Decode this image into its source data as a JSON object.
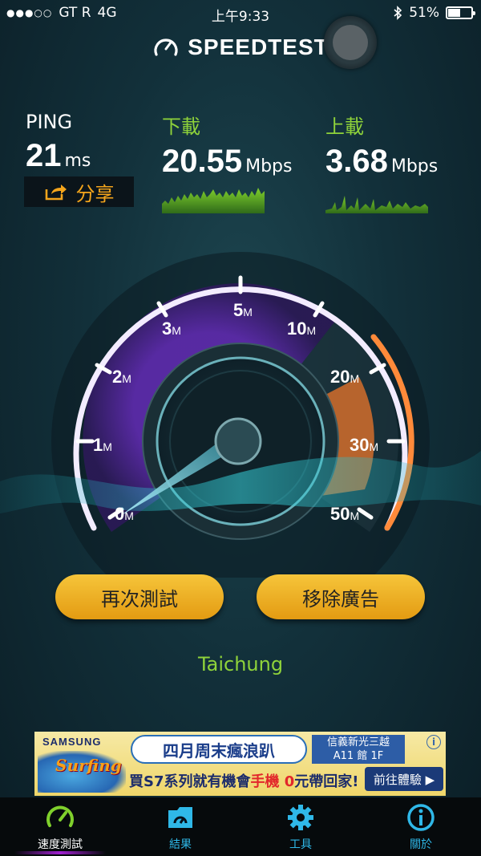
{
  "status_bar": {
    "signal": "●●●○○",
    "carrier": "GT R",
    "network": "4G",
    "time": "上午9:33",
    "bluetooth_icon": "bluetooth-icon",
    "battery_percent": "51%",
    "battery_level": 0.51
  },
  "header": {
    "app_name": "SPEEDTEST",
    "logo_icon": "speedometer-icon"
  },
  "results": {
    "ping": {
      "label": "PING",
      "value": "21",
      "unit": "ms"
    },
    "download": {
      "label": "下載",
      "value": "20.55",
      "unit": "Mbps"
    },
    "upload": {
      "label": "上載",
      "value": "3.68",
      "unit": "Mbps"
    }
  },
  "share": {
    "label": "分享",
    "icon": "share-icon"
  },
  "gauge": {
    "labels": [
      {
        "num": "0",
        "unit": "M"
      },
      {
        "num": "1",
        "unit": "M"
      },
      {
        "num": "2",
        "unit": "M"
      },
      {
        "num": "3",
        "unit": "M"
      },
      {
        "num": "5",
        "unit": "M"
      },
      {
        "num": "10",
        "unit": "M"
      },
      {
        "num": "20",
        "unit": "M"
      },
      {
        "num": "30",
        "unit": "M"
      },
      {
        "num": "50",
        "unit": "M"
      }
    ],
    "needle_value_mbps": 0,
    "fill_color": "#7a3fd0",
    "end_color": "#e0792a"
  },
  "actions": {
    "retest_label": "再次測試",
    "remove_ads_label": "移除廣告"
  },
  "location": "Taichung",
  "ad": {
    "brand": "SAMSUNG",
    "logo_text": "Surfing",
    "headline": "四月周末瘋浪趴",
    "store_line1": "信義新光三越",
    "store_line2": "A11 館 1F",
    "promo_prefix": "買S7系列就有機會",
    "promo_highlight": "手機 0",
    "promo_suffix": "元帶回家!",
    "cta": "前往體驗 ▶",
    "info": "i",
    "accent_color": "#2d5da6"
  },
  "tabs": [
    {
      "label": "速度測試",
      "icon": "speedometer-icon",
      "active": true
    },
    {
      "label": "結果",
      "icon": "results-folder-icon",
      "active": false
    },
    {
      "label": "工具",
      "icon": "gear-icon",
      "active": false
    },
    {
      "label": "關於",
      "icon": "info-icon",
      "active": false
    }
  ]
}
